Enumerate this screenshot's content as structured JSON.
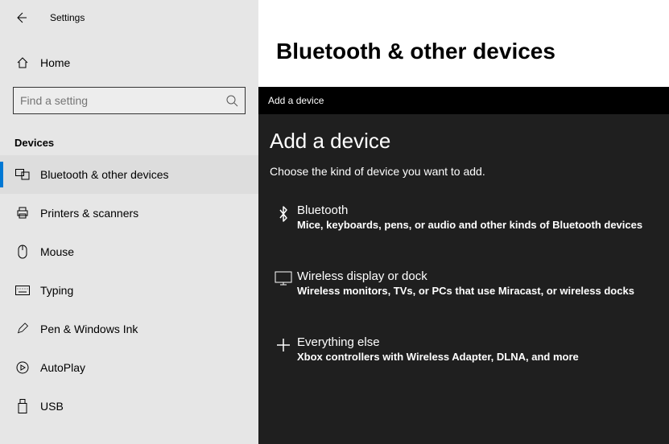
{
  "settings_label": "Settings",
  "home_label": "Home",
  "search_placeholder": "Find a setting",
  "section_title": "Devices",
  "nav": [
    {
      "label": "Bluetooth & other devices"
    },
    {
      "label": "Printers & scanners"
    },
    {
      "label": "Mouse"
    },
    {
      "label": "Typing"
    },
    {
      "label": "Pen & Windows Ink"
    },
    {
      "label": "AutoPlay"
    },
    {
      "label": "USB"
    }
  ],
  "page_title": "Bluetooth & other devices",
  "dialog": {
    "titlebar": "Add a device",
    "heading": "Add a device",
    "subheading": "Choose the kind of device you want to add.",
    "options": [
      {
        "title": "Bluetooth",
        "desc": "Mice, keyboards, pens, or audio and other kinds of Bluetooth devices"
      },
      {
        "title": "Wireless display or dock",
        "desc": "Wireless monitors, TVs, or PCs that use Miracast, or wireless docks"
      },
      {
        "title": "Everything else",
        "desc": "Xbox controllers with Wireless Adapter, DLNA, and more"
      }
    ]
  }
}
